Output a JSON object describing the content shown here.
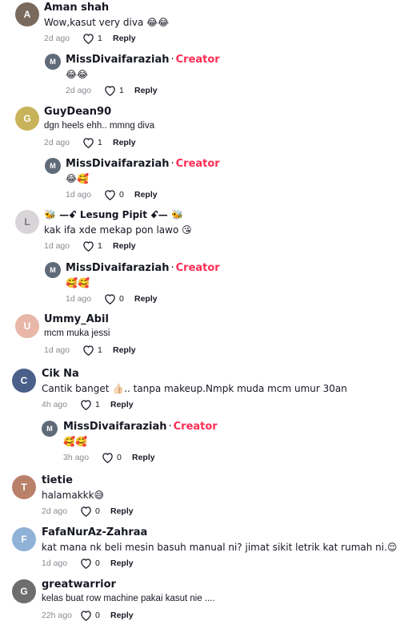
{
  "comments": [
    {
      "name": "Aman shah",
      "text": "Wow,kasut very diva 😂😂",
      "time": "2d ago",
      "likes": "1",
      "reply": "Reply",
      "avatar_color": "#7a6a5d"
    },
    {
      "name": "MissDivaifaraziah",
      "creator": "Creator",
      "sep": "·",
      "text": "😂😂",
      "time": "2d ago",
      "likes": "1",
      "reply": "Reply",
      "avatar_color": "#5f6b78"
    },
    {
      "name": "GuyDean90",
      "text": "dgn heels ehh.. mmng diva",
      "time": "2d ago",
      "likes": "1",
      "reply": "Reply",
      "avatar_color": "#c9b35a"
    },
    {
      "name": "MissDivaifaraziah",
      "creator": "Creator",
      "sep": "·",
      "text": "😂🥰",
      "time": "1d ago",
      "likes": "0",
      "reply": "Reply",
      "avatar_color": "#5f6b78"
    },
    {
      "name": "🐝 —ꗃ Lesung Pipit ꗃ— 🐝",
      "text": "kak ifa xde mekap pon lawo 😘",
      "time": "1d ago",
      "likes": "1",
      "reply": "Reply",
      "avatar_color": "#d9d4d8"
    },
    {
      "name": "MissDivaifaraziah",
      "creator": "Creator",
      "sep": "·",
      "text": "🥰🥰",
      "time": "1d ago",
      "likes": "0",
      "reply": "Reply",
      "avatar_color": "#5f6b78"
    },
    {
      "name": "Ummy_Abil",
      "text": "mcm muka jessi",
      "time": "1d ago",
      "likes": "1",
      "reply": "Reply",
      "avatar_color": "#e8b7a8"
    },
    {
      "name": "Cik Na",
      "text": "Cantik banget 👍🏻.. tanpa makeup.Nmpk muda mcm umur 30an",
      "time": "4h ago",
      "likes": "1",
      "reply": "Reply",
      "avatar_color": "#4a5f8a"
    },
    {
      "name": "MissDivaifaraziah",
      "creator": "Creator",
      "sep": "·",
      "text": "🥰🥰",
      "time": "3h ago",
      "likes": "0",
      "reply": "Reply",
      "avatar_color": "#5f6b78"
    },
    {
      "name": "tietie",
      "text": "halamakkk😅",
      "time": "2d ago",
      "likes": "0",
      "reply": "Reply",
      "avatar_color": "#b9806a"
    },
    {
      "name": "FafaNurAz-Zahraa",
      "text": "kat mana nk beli mesin basuh manual ni? jimat sikit letrik kat rumah ni.😌",
      "time": "1d ago",
      "likes": "0",
      "reply": "Reply",
      "avatar_color": "#8fb2d6"
    },
    {
      "name": "greatwarrior",
      "text": "kelas buat row machine pakai kasut nie ....",
      "time": "22h ago",
      "likes": "0",
      "reply": "Reply",
      "avatar_color": "#6e6e6e"
    }
  ]
}
